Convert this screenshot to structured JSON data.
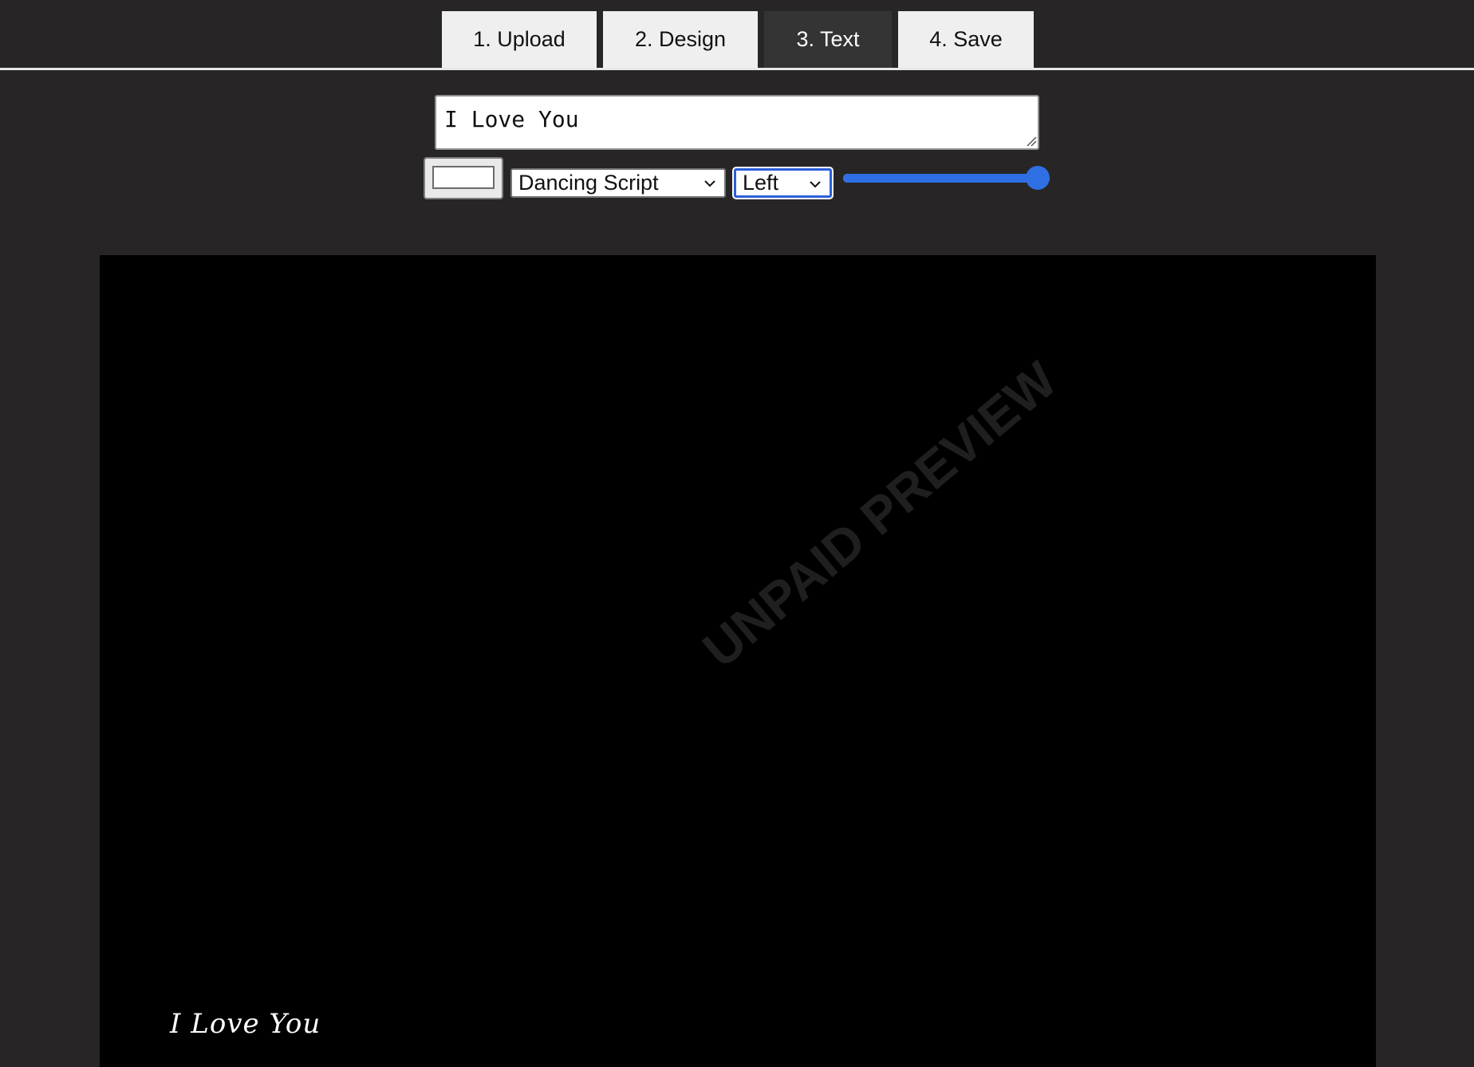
{
  "tabs": [
    {
      "label": "1. Upload",
      "active": false
    },
    {
      "label": "2. Design",
      "active": false
    },
    {
      "label": "3. Text",
      "active": true
    },
    {
      "label": "4. Save",
      "active": false
    }
  ],
  "editor": {
    "text_value": "I Love You",
    "text_color": "#ffffff",
    "font_select": {
      "selected": "Dancing Script"
    },
    "align_select": {
      "selected": "Left"
    },
    "size_slider": {
      "value_fraction": 1.0
    }
  },
  "preview": {
    "caption": "I Love You",
    "watermark": "UNPAID PREVIEW"
  },
  "colors": {
    "background": "#272526",
    "accent": "#2f6fe4",
    "tab_active": "#353434",
    "tab_inactive": "#efefef"
  }
}
